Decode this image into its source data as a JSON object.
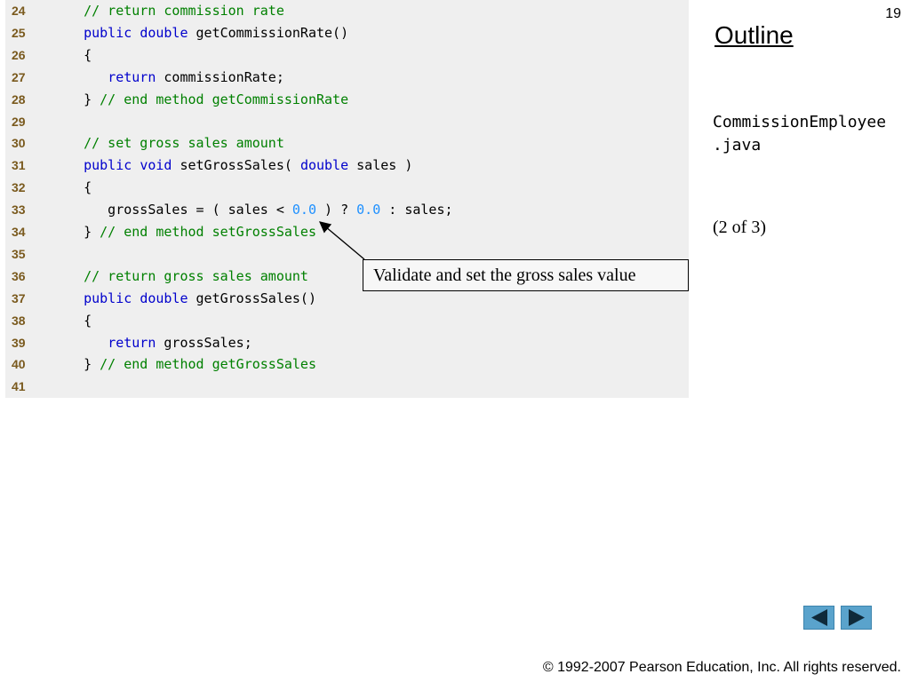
{
  "slide": {
    "page_number": "19",
    "outline_title": "Outline",
    "file_name_line1": "CommissionEmployee",
    "file_name_line2": ".java",
    "page_of": "(2 of 3)",
    "callout_text": "Validate and set the gross sales value",
    "copyright": "© 1992-2007 Pearson Education, Inc.  All rights reserved."
  },
  "nav": {
    "prev_icon": "triangle-left-icon",
    "next_icon": "triangle-right-icon",
    "button_color": "#5aa3cc"
  },
  "code_lines": [
    {
      "num": "24",
      "tokens": [
        {
          "t": "   "
        },
        {
          "t": "// return commission rate",
          "c": "cm"
        }
      ]
    },
    {
      "num": "25",
      "tokens": [
        {
          "t": "   "
        },
        {
          "t": "public",
          "c": "kw"
        },
        {
          "t": " "
        },
        {
          "t": "double",
          "c": "kw"
        },
        {
          "t": " getCommissionRate()"
        }
      ]
    },
    {
      "num": "26",
      "tokens": [
        {
          "t": "   {"
        }
      ]
    },
    {
      "num": "27",
      "tokens": [
        {
          "t": "      "
        },
        {
          "t": "return",
          "c": "kw"
        },
        {
          "t": " commissionRate;"
        }
      ]
    },
    {
      "num": "28",
      "tokens": [
        {
          "t": "   } "
        },
        {
          "t": "// end method getCommissionRate",
          "c": "cm"
        }
      ]
    },
    {
      "num": "29",
      "tokens": [
        {
          "t": ""
        }
      ]
    },
    {
      "num": "30",
      "tokens": [
        {
          "t": "   "
        },
        {
          "t": "// set gross sales amount",
          "c": "cm"
        }
      ]
    },
    {
      "num": "31",
      "tokens": [
        {
          "t": "   "
        },
        {
          "t": "public",
          "c": "kw"
        },
        {
          "t": " "
        },
        {
          "t": "void",
          "c": "kw"
        },
        {
          "t": " setGrossSales( "
        },
        {
          "t": "double",
          "c": "kw"
        },
        {
          "t": " sales )"
        }
      ]
    },
    {
      "num": "32",
      "tokens": [
        {
          "t": "   {"
        }
      ]
    },
    {
      "num": "33",
      "tokens": [
        {
          "t": "      grossSales = ( sales < "
        },
        {
          "t": "0.0",
          "c": "num"
        },
        {
          "t": " ) ? "
        },
        {
          "t": "0.0",
          "c": "num"
        },
        {
          "t": " : sales;"
        }
      ]
    },
    {
      "num": "34",
      "tokens": [
        {
          "t": "   } "
        },
        {
          "t": "// end method setGrossSales",
          "c": "cm"
        }
      ]
    },
    {
      "num": "35",
      "tokens": [
        {
          "t": ""
        }
      ]
    },
    {
      "num": "36",
      "tokens": [
        {
          "t": "   "
        },
        {
          "t": "// return gross sales amount",
          "c": "cm"
        }
      ]
    },
    {
      "num": "37",
      "tokens": [
        {
          "t": "   "
        },
        {
          "t": "public",
          "c": "kw"
        },
        {
          "t": " "
        },
        {
          "t": "double",
          "c": "kw"
        },
        {
          "t": " getGrossSales()"
        }
      ]
    },
    {
      "num": "38",
      "tokens": [
        {
          "t": "   {"
        }
      ]
    },
    {
      "num": "39",
      "tokens": [
        {
          "t": "      "
        },
        {
          "t": "return",
          "c": "kw"
        },
        {
          "t": " grossSales;"
        }
      ]
    },
    {
      "num": "40",
      "tokens": [
        {
          "t": "   } "
        },
        {
          "t": "// end method getGrossSales",
          "c": "cm"
        }
      ]
    },
    {
      "num": "41",
      "tokens": [
        {
          "t": ""
        }
      ]
    }
  ]
}
